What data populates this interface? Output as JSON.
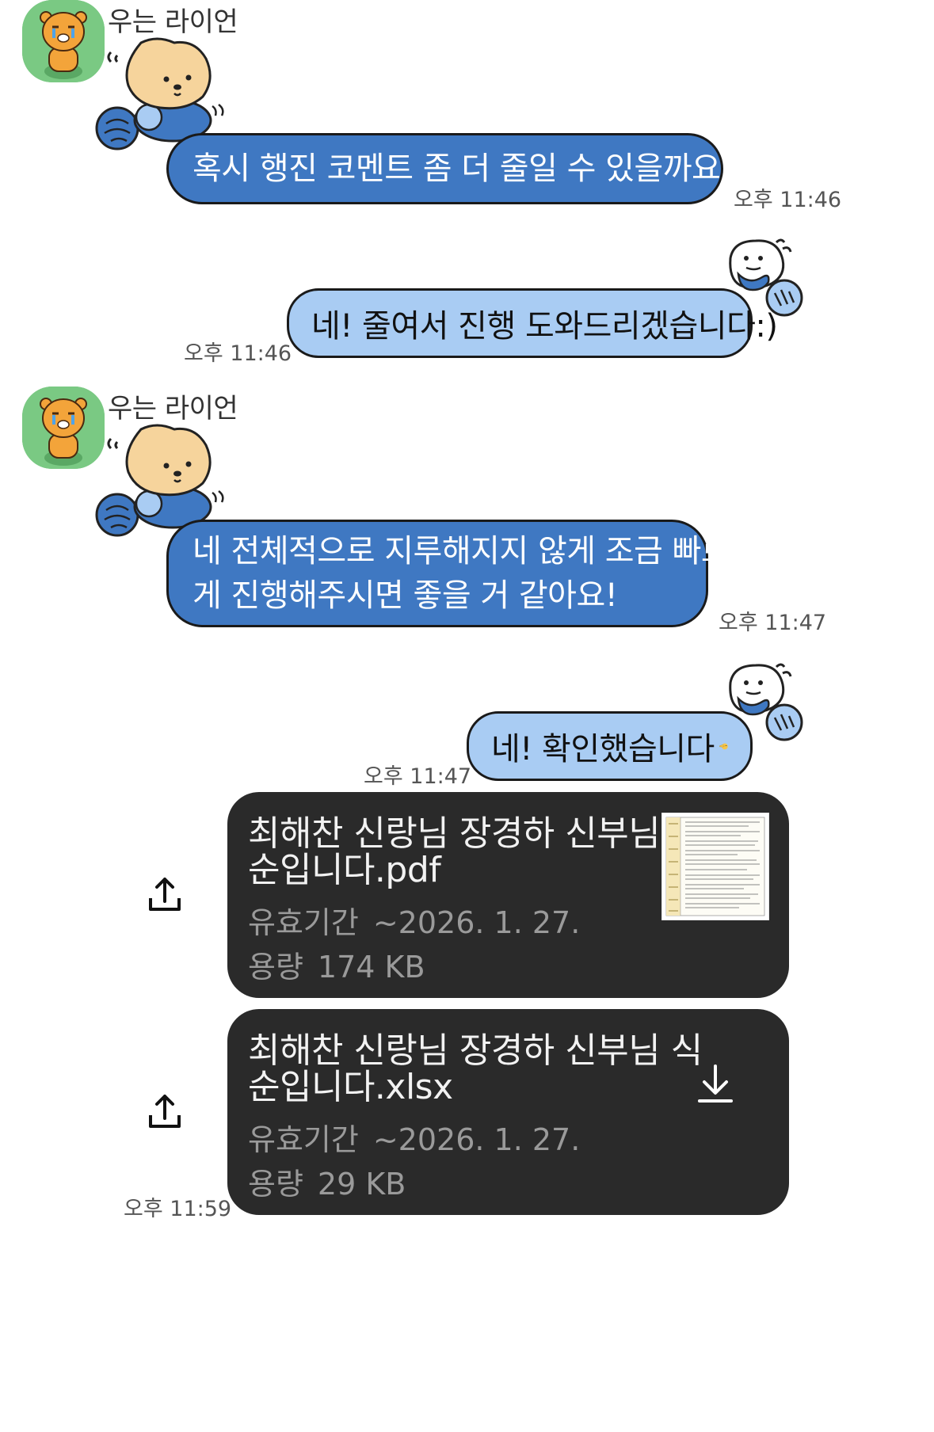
{
  "messages": [
    {
      "sender": "우는 라이언",
      "text": "혹시 행진 코멘트 좀 더 줄일 수 있을까요?!",
      "time": "오후 11:46"
    },
    {
      "text": "네! 줄여서 진행 도와드리겠습니다:)",
      "time": "오후 11:46"
    },
    {
      "sender": "우는 라이언",
      "line1": "네 전체적으로 지루해지지 않게 조금 빠르",
      "line2": "게 진행해주시면 좋을 거 같아요!",
      "time": "오후 11:47"
    },
    {
      "text": "네! 확인했습니다",
      "time": "오후 11:47"
    }
  ],
  "files": [
    {
      "name_line1": "최해찬 신랑님 장경하 신부님 식",
      "name_line2": "순입니다.pdf",
      "expiry_label": "유효기간",
      "expiry": "~2026. 1. 27.",
      "size_label": "용량",
      "size": "174 KB"
    },
    {
      "name_line1": "최해찬 신랑님 장경하 신부님 식",
      "name_line2": "순입니다.xlsx",
      "expiry_label": "유효기간",
      "expiry": "~2026. 1. 27.",
      "size_label": "용량",
      "size": "29 KB",
      "time": "오후 11:59"
    }
  ],
  "icons": {
    "avatar": "crying-lion-avatar",
    "sticker_in": "knitting-bear-sticker",
    "sticker_out": "knitting-bear-sticker",
    "share": "share-icon",
    "download": "download-icon",
    "emoji": "pointing-hand-face-emoji"
  },
  "colors": {
    "bubble_in": "#3f78c2",
    "bubble_out": "#a9ccf3",
    "file_card": "#2a2a2a",
    "avatar_bg": "#7ac983"
  }
}
